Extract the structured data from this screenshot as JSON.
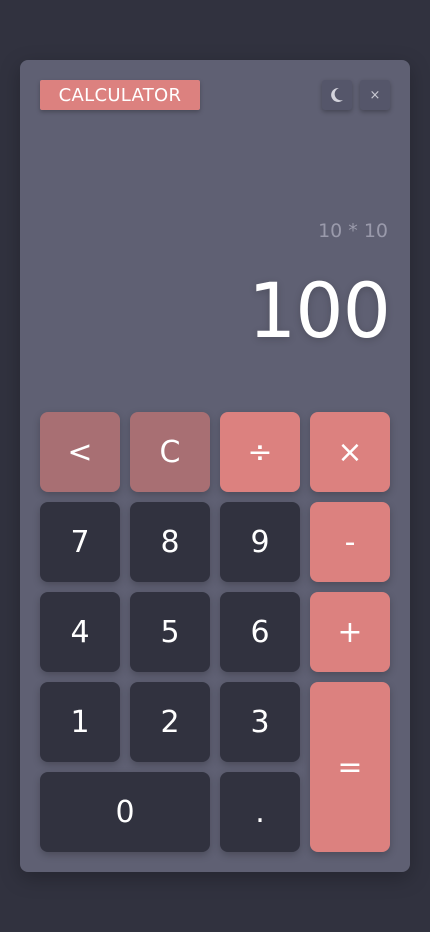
{
  "app": {
    "title": "CALCULATOR",
    "theme_icon": "crescent-moon-icon",
    "close_label": "×"
  },
  "display": {
    "expression": "10 * 10",
    "result": "100"
  },
  "keys": {
    "back": "<",
    "clear": "C",
    "divide": "÷",
    "multiply": "×",
    "seven": "7",
    "eight": "8",
    "nine": "9",
    "minus": "-",
    "four": "4",
    "five": "5",
    "six": "6",
    "plus": "+",
    "one": "1",
    "two": "2",
    "three": "3",
    "equals": "=",
    "zero": "0",
    "dot": "."
  },
  "colors": {
    "page_background": "#31323f",
    "panel": "#5f6073",
    "number_key": "#31323f",
    "function_key": "#a86f73",
    "operator_key": "#dc817f",
    "title_badge": "#dc817f"
  }
}
